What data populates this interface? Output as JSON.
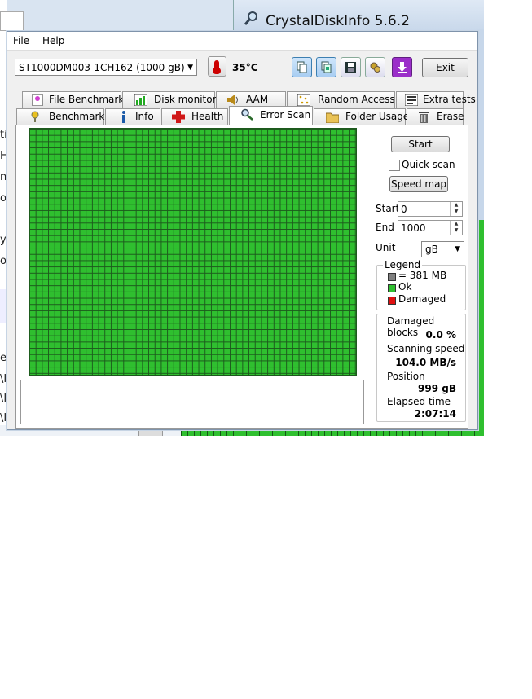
{
  "background": {
    "app_title": "CrystalDiskInfo 5.6.2",
    "fragments": [
      "ti",
      "H",
      "ni",
      "ol",
      "ys",
      "or",
      "e",
      "\\I",
      "\\I",
      "\\I"
    ]
  },
  "menu": {
    "file": "File",
    "help": "Help"
  },
  "toolbar": {
    "drive": "ST1000DM003-1CH162 (1000 gB)",
    "temperature": "35°C",
    "exit_label": "Exit"
  },
  "tabs_top": [
    {
      "label": "File Benchmark",
      "icon": "file-benchmark-icon"
    },
    {
      "label": "Disk monitor",
      "icon": "disk-monitor-icon"
    },
    {
      "label": "AAM",
      "icon": "speaker-icon"
    },
    {
      "label": "Random Access",
      "icon": "random-access-icon"
    },
    {
      "label": "Extra tests",
      "icon": "extra-tests-icon"
    }
  ],
  "tabs_bottom": [
    {
      "label": "Benchmark",
      "icon": "benchmark-icon"
    },
    {
      "label": "Info",
      "icon": "info-icon"
    },
    {
      "label": "Health",
      "icon": "health-cross-icon"
    },
    {
      "label": "Error Scan",
      "icon": "magnifier-icon",
      "active": true
    },
    {
      "label": "Folder Usage",
      "icon": "folder-icon"
    },
    {
      "label": "Erase",
      "icon": "trash-icon"
    }
  ],
  "scan": {
    "start_button": "Start",
    "quick_scan_label": "Quick scan",
    "quick_scan_checked": false,
    "speed_map_button": "Speed map",
    "start_label": "Start",
    "start_value": "0",
    "end_label": "End",
    "end_value": "1000",
    "unit_label": "Unit",
    "unit_value": "gB"
  },
  "legend": {
    "title": "Legend",
    "items": [
      {
        "label": "= 381 MB",
        "color": "#808080"
      },
      {
        "label": "Ok",
        "color": "#2fbf2f"
      },
      {
        "label": "Damaged",
        "color": "#e01010"
      }
    ]
  },
  "stats": {
    "damaged_label": "Damaged blocks",
    "damaged_value": "0.0 %",
    "speed_label": "Scanning speed",
    "speed_value": "104.0 MB/s",
    "position_label": "Position",
    "position_value": "999 gB",
    "elapsed_label": "Elapsed time",
    "elapsed_value": "2:07:14"
  },
  "colors": {
    "ok_green": "#2fbf2f",
    "grid_line": "#1d5a1d"
  }
}
